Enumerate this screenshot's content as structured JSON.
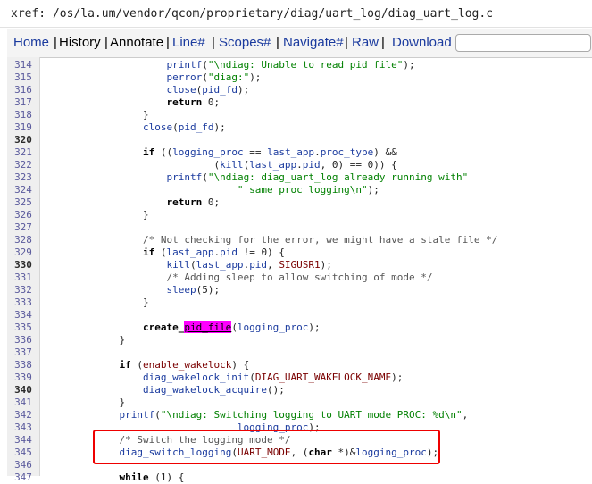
{
  "xref_path": "xref: /os/la.um/vendor/qcom/proprietary/diag/uart_log/diag_uart_log.c",
  "nav": {
    "home": "Home",
    "history": "History",
    "annotate": "Annotate",
    "line": "Line#",
    "scopes": "Scopes#",
    "navigate": "Navigate#",
    "raw": "Raw",
    "download": "Download",
    "separator": "|"
  },
  "lines": [
    {
      "n": "314",
      "bold": false,
      "tokens": [
        [
          "t",
          "\t\t\t\t\t"
        ],
        [
          "fn",
          "printf"
        ],
        [
          "t",
          "("
        ],
        [
          "str",
          "\"\\ndiag: Unable to read pid file\""
        ],
        [
          "t",
          ");"
        ]
      ]
    },
    {
      "n": "315",
      "bold": false,
      "tokens": [
        [
          "t",
          "\t\t\t\t\t"
        ],
        [
          "fn",
          "perror"
        ],
        [
          "t",
          "("
        ],
        [
          "str",
          "\"diag:\""
        ],
        [
          "t",
          ");"
        ]
      ]
    },
    {
      "n": "316",
      "bold": false,
      "tokens": [
        [
          "t",
          "\t\t\t\t\t"
        ],
        [
          "fn",
          "close"
        ],
        [
          "t",
          "("
        ],
        [
          "fn",
          "pid_fd"
        ],
        [
          "t",
          ");"
        ]
      ]
    },
    {
      "n": "317",
      "bold": false,
      "tokens": [
        [
          "t",
          "\t\t\t\t\t"
        ],
        [
          "kw",
          "return"
        ],
        [
          "t",
          " 0;"
        ]
      ]
    },
    {
      "n": "318",
      "bold": false,
      "tokens": [
        [
          "t",
          "\t\t\t\t}"
        ]
      ]
    },
    {
      "n": "319",
      "bold": false,
      "tokens": [
        [
          "t",
          "\t\t\t\t"
        ],
        [
          "fn",
          "close"
        ],
        [
          "t",
          "("
        ],
        [
          "fn",
          "pid_fd"
        ],
        [
          "t",
          ");"
        ]
      ]
    },
    {
      "n": "320",
      "bold": true,
      "tokens": []
    },
    {
      "n": "321",
      "bold": false,
      "tokens": [
        [
          "t",
          "\t\t\t\t"
        ],
        [
          "kw",
          "if"
        ],
        [
          "t",
          " (("
        ],
        [
          "fn",
          "logging_proc"
        ],
        [
          "t",
          " == "
        ],
        [
          "fn",
          "last_app"
        ],
        [
          "t",
          "."
        ],
        [
          "fn",
          "proc_type"
        ],
        [
          "t",
          ") &&"
        ]
      ]
    },
    {
      "n": "322",
      "bold": false,
      "tokens": [
        [
          "t",
          "\t\t\t\t\t\t\t("
        ],
        [
          "fn",
          "kill"
        ],
        [
          "t",
          "("
        ],
        [
          "fn",
          "last_app"
        ],
        [
          "t",
          "."
        ],
        [
          "fn",
          "pid"
        ],
        [
          "t",
          ", 0) == 0)) {"
        ]
      ]
    },
    {
      "n": "323",
      "bold": false,
      "tokens": [
        [
          "t",
          "\t\t\t\t\t"
        ],
        [
          "fn",
          "printf"
        ],
        [
          "t",
          "("
        ],
        [
          "str",
          "\"\\ndiag: diag_uart_log already running with\""
        ]
      ]
    },
    {
      "n": "324",
      "bold": false,
      "tokens": [
        [
          "t",
          "\t\t\t\t\t\t\t\t"
        ],
        [
          "str",
          "\" same proc logging\\n\""
        ],
        [
          "t",
          ");"
        ]
      ]
    },
    {
      "n": "325",
      "bold": false,
      "tokens": [
        [
          "t",
          "\t\t\t\t\t"
        ],
        [
          "kw",
          "return"
        ],
        [
          "t",
          " 0;"
        ]
      ]
    },
    {
      "n": "326",
      "bold": false,
      "tokens": [
        [
          "t",
          "\t\t\t\t}"
        ]
      ]
    },
    {
      "n": "327",
      "bold": false,
      "tokens": []
    },
    {
      "n": "328",
      "bold": false,
      "tokens": [
        [
          "t",
          "\t\t\t\t"
        ],
        [
          "cmt",
          "/* Not checking for the error, we might have a stale file */"
        ]
      ]
    },
    {
      "n": "329",
      "bold": false,
      "tokens": [
        [
          "t",
          "\t\t\t\t"
        ],
        [
          "kw",
          "if"
        ],
        [
          "t",
          " ("
        ],
        [
          "fn",
          "last_app"
        ],
        [
          "t",
          "."
        ],
        [
          "fn",
          "pid"
        ],
        [
          "t",
          " != 0) {"
        ]
      ]
    },
    {
      "n": "330",
      "bold": true,
      "tokens": [
        [
          "t",
          "\t\t\t\t\t"
        ],
        [
          "fn",
          "kill"
        ],
        [
          "t",
          "("
        ],
        [
          "fn",
          "last_app"
        ],
        [
          "t",
          "."
        ],
        [
          "fn",
          "pid"
        ],
        [
          "t",
          ", "
        ],
        [
          "mac",
          "SIGUSR1"
        ],
        [
          "t",
          ");"
        ]
      ]
    },
    {
      "n": "331",
      "bold": false,
      "tokens": [
        [
          "t",
          "\t\t\t\t\t"
        ],
        [
          "cmt",
          "/* Adding sleep to allow switching of mode */"
        ]
      ]
    },
    {
      "n": "332",
      "bold": false,
      "tokens": [
        [
          "t",
          "\t\t\t\t\t"
        ],
        [
          "fn",
          "sleep"
        ],
        [
          "t",
          "(5);"
        ]
      ]
    },
    {
      "n": "333",
      "bold": false,
      "tokens": [
        [
          "t",
          "\t\t\t\t}"
        ]
      ]
    },
    {
      "n": "334",
      "bold": false,
      "tokens": []
    },
    {
      "n": "335",
      "bold": false,
      "tokens": [
        [
          "t",
          "\t\t\t\t"
        ],
        [
          "kw",
          "create_"
        ],
        [
          "hl",
          "pid_file"
        ],
        [
          "t",
          "("
        ],
        [
          "fn",
          "logging_proc"
        ],
        [
          "t",
          ");"
        ]
      ]
    },
    {
      "n": "336",
      "bold": false,
      "tokens": [
        [
          "t",
          "\t\t\t}"
        ]
      ]
    },
    {
      "n": "337",
      "bold": false,
      "tokens": []
    },
    {
      "n": "338",
      "bold": false,
      "tokens": [
        [
          "t",
          "\t\t\t"
        ],
        [
          "kw",
          "if"
        ],
        [
          "t",
          " ("
        ],
        [
          "mac",
          "enable_wakelock"
        ],
        [
          "t",
          ") {"
        ]
      ]
    },
    {
      "n": "339",
      "bold": false,
      "tokens": [
        [
          "t",
          "\t\t\t\t"
        ],
        [
          "fn",
          "diag_wakelock_init"
        ],
        [
          "t",
          "("
        ],
        [
          "mac",
          "DIAG_UART_WAKELOCK_NAME"
        ],
        [
          "t",
          ");"
        ]
      ]
    },
    {
      "n": "340",
      "bold": true,
      "tokens": [
        [
          "t",
          "\t\t\t\t"
        ],
        [
          "fn",
          "diag_wakelock_acquire"
        ],
        [
          "t",
          "();"
        ]
      ]
    },
    {
      "n": "341",
      "bold": false,
      "tokens": [
        [
          "t",
          "\t\t\t}"
        ]
      ]
    },
    {
      "n": "342",
      "bold": false,
      "tokens": [
        [
          "t",
          "\t\t\t"
        ],
        [
          "fn",
          "printf"
        ],
        [
          "t",
          "("
        ],
        [
          "str",
          "\"\\ndiag: Switching logging to UART mode PROC: %d\\n\""
        ],
        [
          "t",
          ","
        ]
      ]
    },
    {
      "n": "343",
      "bold": false,
      "tokens": [
        [
          "t",
          "\t\t\t\t\t\t\t\t"
        ],
        [
          "fn",
          "logging_proc"
        ],
        [
          "t",
          ");"
        ]
      ]
    },
    {
      "n": "344",
      "bold": false,
      "tokens": [
        [
          "t",
          "\t\t\t"
        ],
        [
          "cmt",
          "/* Switch the logging mode */"
        ]
      ]
    },
    {
      "n": "345",
      "bold": false,
      "tokens": [
        [
          "t",
          "\t\t\t"
        ],
        [
          "fn",
          "diag_switch_logging"
        ],
        [
          "t",
          "("
        ],
        [
          "mac",
          "UART_MODE"
        ],
        [
          "t",
          ", ("
        ],
        [
          "kw",
          "char"
        ],
        [
          "t",
          " *)&"
        ],
        [
          "fn",
          "logging_proc"
        ],
        [
          "t",
          ");"
        ]
      ]
    },
    {
      "n": "346",
      "bold": false,
      "tokens": []
    },
    {
      "n": "347",
      "bold": false,
      "tokens": [
        [
          "t",
          "\t\t\t"
        ],
        [
          "kw",
          "while"
        ],
        [
          "t",
          " (1) {"
        ]
      ]
    }
  ]
}
